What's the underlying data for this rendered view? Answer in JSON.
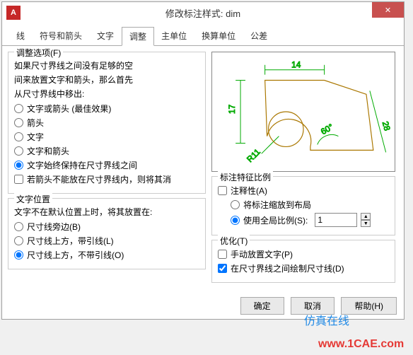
{
  "window": {
    "title": "修改标注样式: dim"
  },
  "tabs": [
    "线",
    "符号和箭头",
    "文字",
    "调整",
    "主单位",
    "换算单位",
    "公差"
  ],
  "activeTab": 3,
  "fitOptions": {
    "title": "调整选项(F)",
    "desc1": "如果尺寸界线之间没有足够的空",
    "desc2": "间来放置文字和箭头，那么首先",
    "desc3": "从尺寸界线中移出:",
    "r1": "文字或箭头 (最佳效果)",
    "r2": "箭头",
    "r3": "文字",
    "r4": "文字和箭头",
    "r5": "文字始终保持在尺寸界线之间",
    "c1": "若箭头不能放在尺寸界线内，则将其消"
  },
  "textPlacement": {
    "title": "文字位置",
    "desc": "文字不在默认位置上时，将其放置在:",
    "r1": "尺寸线旁边(B)",
    "r2": "尺寸线上方，带引线(L)",
    "r3": "尺寸线上方，不带引线(O)"
  },
  "scale": {
    "title": "标注特征比例",
    "c1": "注释性(A)",
    "r1": "将标注缩放到布局",
    "r2": "使用全局比例(S):",
    "value": "1"
  },
  "fineTune": {
    "title": "优化(T)",
    "c1": "手动放置文字(P)",
    "c2": "在尺寸界线之间绘制尺寸线(D)"
  },
  "buttons": {
    "ok": "确定",
    "cancel": "取消",
    "help": "帮助(H)"
  },
  "preview": {
    "d1": "14",
    "d2": "17",
    "d3": "28",
    "angle": "60°",
    "radius": "R11"
  },
  "watermarks": {
    "w1": "仿真在线",
    "w2": "www.1CAE.com"
  }
}
